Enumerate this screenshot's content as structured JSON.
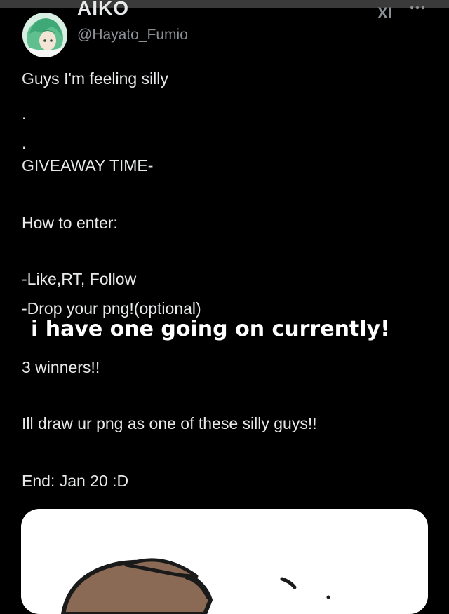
{
  "post": {
    "display_name": "AIKO",
    "handle": "@Hayato_Fumio",
    "brand_mark": "XI",
    "more_icon": "more-dots-icon",
    "lines": [
      "Guys I'm feeling silly",
      ".",
      ".",
      "GIVEAWAY TIME-",
      "How to enter:",
      "-Like,RT, Follow",
      "-Drop your png!(optional)",
      "3 winners!!",
      "Ill draw ur png as one of these silly guys!!",
      "End: Jan 20 :D"
    ]
  },
  "overlay": {
    "caption": "i have one going on currently!"
  },
  "colors": {
    "background": "#000000",
    "text": "#e7e9ea",
    "muted": "#8b9197",
    "card": "#ffffff",
    "sketch_hair": "#8a6a55"
  }
}
